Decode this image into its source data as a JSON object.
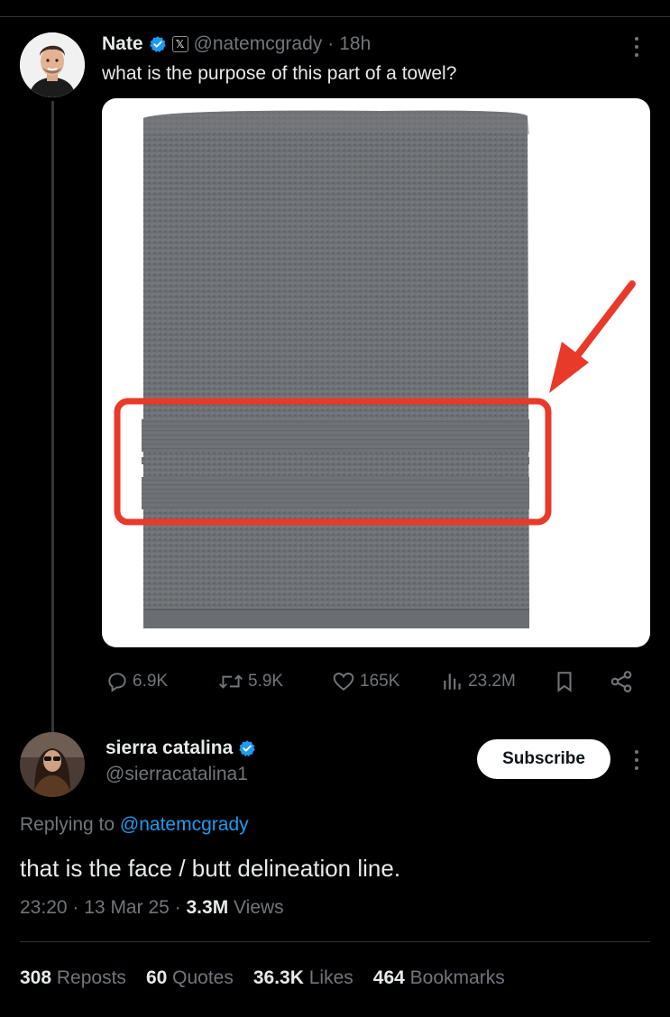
{
  "tweet": {
    "author_name": "Nate",
    "author_handle": "@natemcgrady",
    "time": "18h",
    "separator": "·",
    "text": "what is the purpose of this part of a towel?",
    "actions": {
      "replies": "6.9K",
      "reposts": "5.9K",
      "likes": "165K",
      "views": "23.2M"
    }
  },
  "reply": {
    "author_name": "sierra catalina",
    "author_handle": "@sierracatalina1",
    "subscribe_label": "Subscribe",
    "replying_prefix": "Replying to ",
    "replying_handle": "@natemcgrady",
    "text": "that is the face / butt delineation line.",
    "time": "23:20",
    "date": "13 Mar 25",
    "sep": "·",
    "views_count": "3.3M",
    "views_label": "Views",
    "stats": [
      {
        "count": "308",
        "label": "Reposts"
      },
      {
        "count": "60",
        "label": "Quotes"
      },
      {
        "count": "36.3K",
        "label": "Likes"
      },
      {
        "count": "464",
        "label": "Bookmarks"
      }
    ]
  },
  "colors": {
    "background": "#000000",
    "text": "#e7e9ea",
    "muted": "#71767b",
    "link": "#1d9bf0",
    "verified": "#1d9bf0",
    "highlight": "#e8392a"
  },
  "icons": [
    "verified-badge-icon",
    "x-affiliate-icon",
    "more-icon",
    "reply-icon",
    "repost-icon",
    "like-icon",
    "views-icon",
    "bookmark-icon",
    "share-icon"
  ]
}
